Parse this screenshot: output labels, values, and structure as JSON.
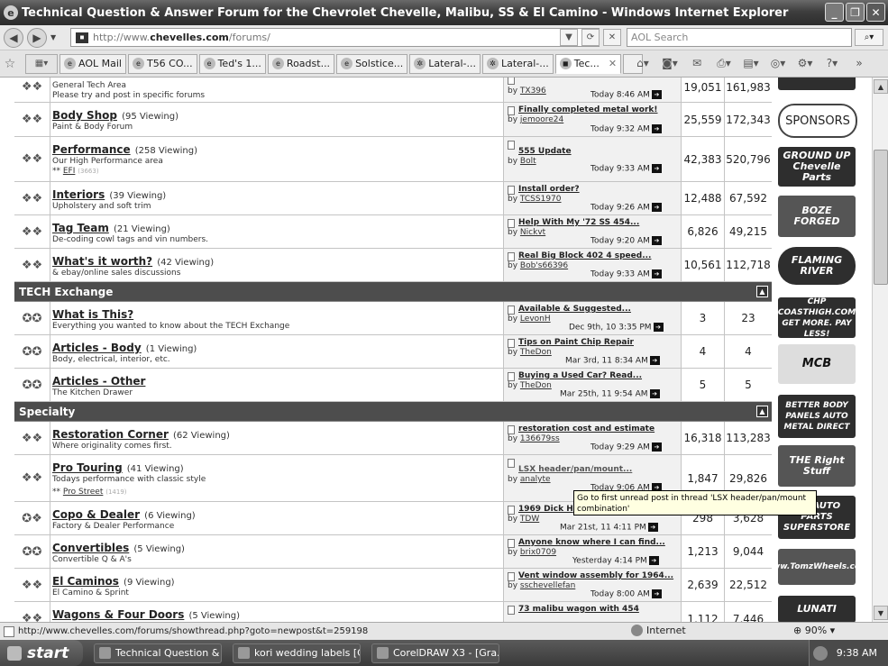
{
  "window": {
    "title": "Technical Question & Answer Forum for the Chevrolet Chevelle, Malibu, SS & El Camino - Windows Internet Explorer"
  },
  "address": {
    "prefix": "http://www.",
    "domain": "chevelles.com",
    "path": "/forums/",
    "search_placeholder": "AOL Search"
  },
  "tabs": [
    {
      "label": "AOL Mail"
    },
    {
      "label": "T56 CO..."
    },
    {
      "label": "Ted's 1..."
    },
    {
      "label": "Roadst..."
    },
    {
      "label": "Solstice..."
    },
    {
      "label": "Lateral-..."
    },
    {
      "label": "Lateral-..."
    },
    {
      "label": "Tec..."
    }
  ],
  "forums": [
    {
      "title": "",
      "viewing": "",
      "desc": "General Tech Area",
      "desc2": "Please try and post in specific forums",
      "last_title": "",
      "last_by": "TX396",
      "last_time": "Today 8:46 AM",
      "threads": "19,051",
      "posts": "161,983"
    },
    {
      "title": "Body Shop",
      "viewing": "(95 Viewing)",
      "desc": "Paint & Body Forum",
      "last_title": "Finally completed metal work!",
      "last_by": "jemoore24",
      "last_time": "Today 9:32 AM",
      "threads": "25,559",
      "posts": "172,343"
    },
    {
      "title": "Performance",
      "viewing": "(258 Viewing)",
      "desc": "Our High Performance area",
      "sub_prefix": "** ",
      "sub": "EFI",
      "sub_count": "(3663)",
      "last_title": "555 Update",
      "last_by": "Bolt",
      "last_time": "Today 9:33 AM",
      "threads": "42,383",
      "posts": "520,796"
    },
    {
      "title": "Interiors",
      "viewing": "(39 Viewing)",
      "desc": "Upholstery and soft trim",
      "last_title": "Install order?",
      "last_by": "TCSS1970",
      "last_time": "Today 9:26 AM",
      "threads": "12,488",
      "posts": "67,592"
    },
    {
      "title": "Tag Team",
      "viewing": "(21 Viewing)",
      "desc": "De-coding cowl tags and vin numbers.",
      "last_title": "Help With My '72 SS 454...",
      "last_by": "Nickvt",
      "last_time": "Today 9:20 AM",
      "threads": "6,826",
      "posts": "49,215"
    },
    {
      "title": "What's it worth?",
      "viewing": "(42 Viewing)",
      "desc": "& ebay/online sales discussions",
      "last_title": "Real Big Block 402 4 speed...",
      "last_by": "Bob's66396",
      "last_time": "Today 9:33 AM",
      "threads": "10,561",
      "posts": "112,718"
    }
  ],
  "cat_tech": {
    "label": "TECH Exchange"
  },
  "tech": [
    {
      "title": "What is This?",
      "viewing": "",
      "desc": "Everything you wanted to know about the TECH Exchange",
      "last_title": "Available & Suggested...",
      "last_by": "LevonH",
      "last_time": "Dec 9th, 10 3:35 PM",
      "threads": "3",
      "posts": "23"
    },
    {
      "title": "Articles - Body",
      "viewing": "(1 Viewing)",
      "desc": "Body, electrical, interior, etc.",
      "last_title": "Tips on Paint Chip Repair",
      "last_by": "TheDon",
      "last_time": "Mar 3rd, 11 8:34 AM",
      "threads": "4",
      "posts": "4"
    },
    {
      "title": "Articles - Other",
      "viewing": "",
      "desc": "The Kitchen Drawer",
      "last_title": "Buying a Used Car? Read...",
      "last_by": "TheDon",
      "last_time": "Mar 25th, 11 9:54 AM",
      "threads": "5",
      "posts": "5"
    }
  ],
  "cat_spec": {
    "label": "Specialty"
  },
  "spec": [
    {
      "title": "Restoration Corner",
      "viewing": "(62 Viewing)",
      "desc": "Where originality comes first.",
      "last_title": "restoration cost and estimate",
      "last_by": "136679ss",
      "last_time": "Today 9:29 AM",
      "threads": "16,318",
      "posts": "113,283"
    },
    {
      "title": "Pro Touring",
      "viewing": "(41 Viewing)",
      "desc": "Todays performance with classic style",
      "sub_prefix": "** ",
      "sub": "Pro Street",
      "sub_count": "(1419)",
      "last_title": "LSX header/pan/mount...",
      "last_by": "analyte",
      "last_time": "Today 9:06 AM",
      "threads": "1,847",
      "posts": "29,826"
    },
    {
      "title": "Copo & Dealer",
      "viewing": "(6 Viewing)",
      "desc": "Factory & Dealer Performance",
      "last_title": "1969 Dick H",
      "last_by": "TDW",
      "last_time": "Mar 21st, 11 4:11 PM",
      "threads": "298",
      "posts": "3,628"
    },
    {
      "title": "Convertibles",
      "viewing": "(5 Viewing)",
      "desc": "Convertible Q & A's",
      "last_title": "Anyone know where I can find...",
      "last_by": "brix0709",
      "last_time": "Yesterday 4:14 PM",
      "threads": "1,213",
      "posts": "9,044"
    },
    {
      "title": "El Caminos",
      "viewing": "(9 Viewing)",
      "desc": "El Camino & Sprint",
      "last_title": "Vent window assembly for 1964...",
      "last_by": "sschevellefan",
      "last_time": "Today 8:00 AM",
      "threads": "2,639",
      "posts": "22,512"
    },
    {
      "title": "Wagons & Four Doors",
      "viewing": "(5 Viewing)",
      "desc": "",
      "last_title": "73 malibu wagon with 454",
      "last_by": "",
      "last_time": "",
      "threads": "1,112",
      "posts": "7,446"
    }
  ],
  "by_label": "by",
  "sponsors": {
    "label": "SPONSORS",
    "ads": [
      "GROUND UP Chevelle Parts",
      "BOZE FORGED",
      "FLAMING RIVER",
      "CHP COASTHIGH.COM GET MORE. PAY LESS!",
      "MCB",
      "BETTER BODY PANELS AUTO METAL DIRECT",
      "THE Right Stuff",
      "GM AUTO PARTS SUPERSTORE",
      "www.TomzWheels.com",
      "LUNATI"
    ]
  },
  "tooltip": "Go to first unread post in thread 'LSX header/pan/mount combination'",
  "status": {
    "url": "http://www.chevelles.com/forums/showthread.php?goto=newpost&t=259198",
    "zone": "Internet",
    "zoom": "90%"
  },
  "taskbar": {
    "start": "start",
    "tasks": [
      "Technical Question & ...",
      "kori wedding labels [C...",
      "CorelDRAW X3 - [Gra..."
    ],
    "clock": "9:38 AM"
  }
}
